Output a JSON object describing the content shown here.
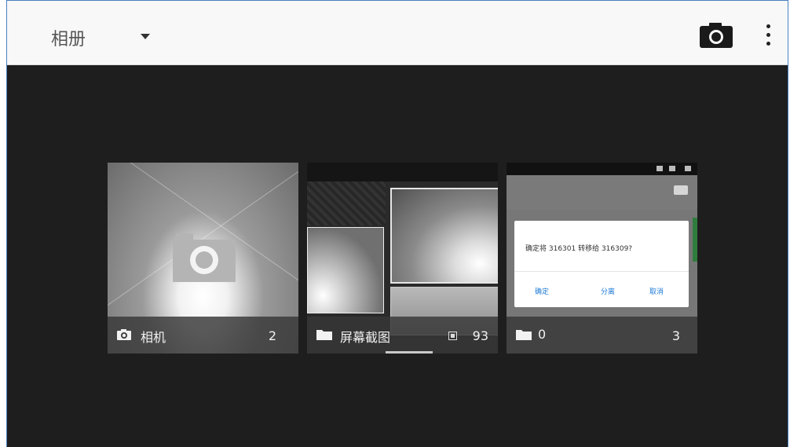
{
  "header": {
    "title": "相册"
  },
  "albums": [
    {
      "name": "相机",
      "count": "2"
    },
    {
      "name": "屏幕截图",
      "count": "93"
    },
    {
      "name": "0",
      "count": "3"
    }
  ],
  "dialog_preview": {
    "message": "确定将 316301 转移给 316309?",
    "buttons": [
      "确定",
      "分离",
      "取消"
    ]
  }
}
